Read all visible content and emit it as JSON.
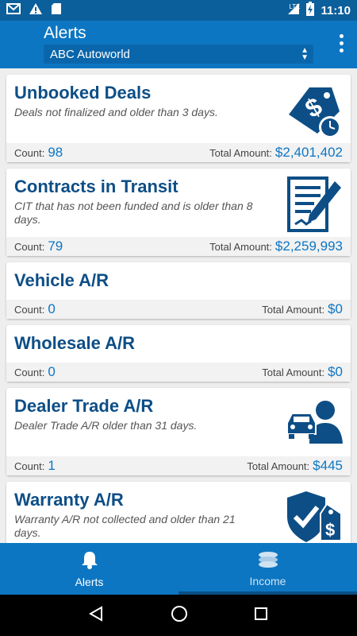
{
  "status_bar": {
    "network": "LTE",
    "time": "11:10"
  },
  "header": {
    "title": "Alerts",
    "dealer_select": "ABC Autoworld"
  },
  "labels": {
    "count": "Count:",
    "total_amount": "Total Amount:"
  },
  "cards": [
    {
      "title": "Unbooked Deals",
      "description": "Deals not finalized and older than 3 days.",
      "count": "98",
      "total": "$2,401,402",
      "icon": "price-tag-clock-icon"
    },
    {
      "title": "Contracts in Transit",
      "description": "CIT that has not been funded and is older than 8 days.",
      "count": "79",
      "total": "$2,259,993",
      "icon": "contract-pen-icon"
    },
    {
      "title": "Vehicle A/R",
      "description": "",
      "count": "0",
      "total": "$0",
      "icon": ""
    },
    {
      "title": "Wholesale A/R",
      "description": "",
      "count": "0",
      "total": "$0",
      "icon": ""
    },
    {
      "title": "Dealer Trade A/R",
      "description": "Dealer Trade A/R older than 31 days.",
      "count": "1",
      "total": "$445",
      "icon": "car-person-icon"
    },
    {
      "title": "Warranty A/R",
      "description": "Warranty A/R not collected and older than 21 days.",
      "count": "",
      "total": "",
      "icon": "shield-check-tag-icon"
    }
  ],
  "bottom_nav": [
    {
      "label": "Alerts",
      "icon": "bell-icon",
      "active": true
    },
    {
      "label": "Income",
      "icon": "coins-icon",
      "active": false
    }
  ],
  "colors": {
    "primary": "#0d76c2",
    "status_bar": "#0b5f9b",
    "card_title": "#0d4e86",
    "value": "#0d76c2"
  }
}
